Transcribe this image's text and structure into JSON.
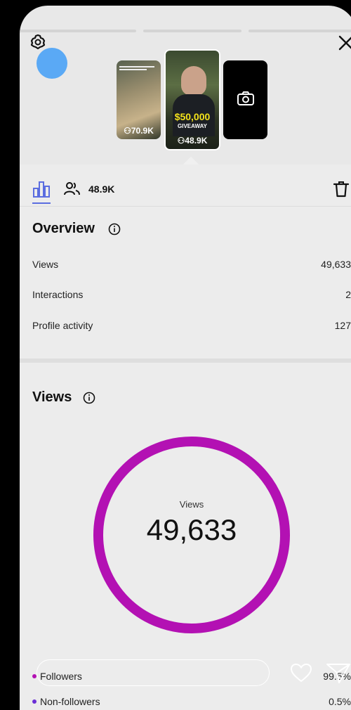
{
  "story_thumbnails": [
    {
      "viewers": "70.9K"
    },
    {
      "promo_amount": "$50,000",
      "promo_word": "GIVEAWAY",
      "viewers": "48.9K"
    },
    {
      "type": "camera"
    }
  ],
  "tabs": {
    "insights_icon": "bar-chart-icon",
    "viewers_icon": "people-icon",
    "viewers_count": "48.9K"
  },
  "overview": {
    "title": "Overview",
    "rows": [
      {
        "label": "Views",
        "value": "49,633"
      },
      {
        "label": "Interactions",
        "value": "2"
      },
      {
        "label": "Profile activity",
        "value": "127"
      }
    ]
  },
  "views": {
    "title": "Views",
    "ring_label": "Views",
    "ring_value": "49,633",
    "legend": [
      {
        "label": "Followers",
        "percent": "99.5%",
        "color": "#b311b3"
      },
      {
        "label": "Non-followers",
        "percent": "0.5%",
        "color": "#6b2fd6"
      }
    ]
  },
  "colors": {
    "accent": "#5b6de0",
    "ring": "#b311b3",
    "avatar": "#5aa9f5"
  }
}
